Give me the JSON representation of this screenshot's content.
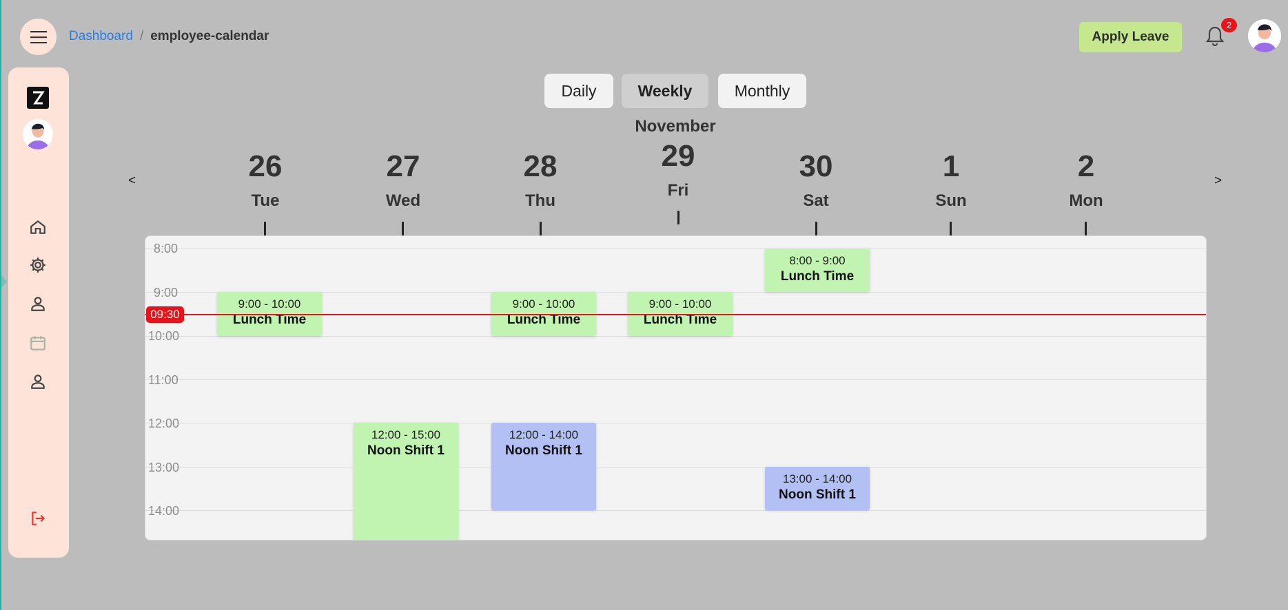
{
  "header": {
    "breadcrumb_link": "Dashboard",
    "breadcrumb_sep": "/",
    "breadcrumb_current": "employee-calendar",
    "apply_label": "Apply Leave",
    "notification_count": "2"
  },
  "views": {
    "daily": "Daily",
    "weekly": "Weekly",
    "monthly": "Monthly",
    "active": "weekly"
  },
  "calendar": {
    "month": "November",
    "prev": "<",
    "next": ">",
    "days": [
      {
        "num": "26",
        "name": "Tue"
      },
      {
        "num": "27",
        "name": "Wed"
      },
      {
        "num": "28",
        "name": "Thu"
      },
      {
        "num": "29",
        "name": "Fri"
      },
      {
        "num": "30",
        "name": "Sat"
      },
      {
        "num": "1",
        "name": "Sun"
      },
      {
        "num": "2",
        "name": "Mon"
      }
    ],
    "hours": [
      "8:00",
      "9:00",
      "10:00",
      "11:00",
      "12:00",
      "13:00",
      "14:00"
    ],
    "now": "09:30",
    "events": [
      {
        "time": "9:00 - 10:00",
        "title": "Lunch Time"
      },
      {
        "time": "9:00 - 10:00",
        "title": "Lunch Time"
      },
      {
        "time": "9:00 - 10:00",
        "title": "Lunch Time"
      },
      {
        "time": "8:00 - 9:00",
        "title": "Lunch Time"
      },
      {
        "time": "12:00 - 15:00",
        "title": "Noon Shift 1"
      },
      {
        "time": "12:00 - 14:00",
        "title": "Noon Shift 1"
      },
      {
        "time": "13:00 - 14:00",
        "title": "Noon Shift 1"
      }
    ]
  },
  "colors": {
    "accent_green": "#c1f3b1",
    "accent_blue": "#b3c0f3",
    "now_red": "#e5141a",
    "sidebar": "#fde3d8"
  },
  "sidebar": {
    "icons": [
      "logo-icon",
      "home-icon",
      "gear-icon",
      "user-icon",
      "calendar-icon",
      "person-icon",
      "logout-icon"
    ]
  }
}
